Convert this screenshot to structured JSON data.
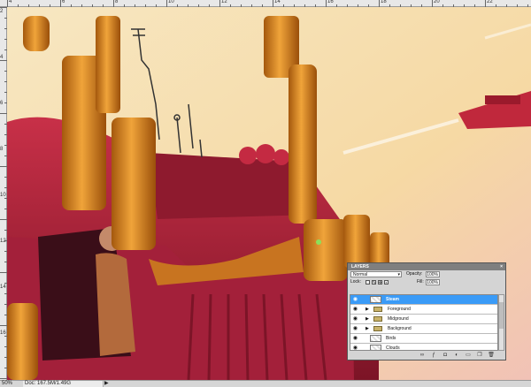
{
  "rulers": {
    "top_numbers": [
      "4",
      "6",
      "8",
      "10",
      "12",
      "14",
      "16",
      "18",
      "20",
      "22",
      "24"
    ],
    "left_numbers": [
      "2",
      "4",
      "6",
      "8",
      "10",
      "12",
      "14",
      "16"
    ]
  },
  "status": {
    "zoom": "50%",
    "doc": "Doc: 167.5M/1.49G",
    "arrow": "▶"
  },
  "layers_panel": {
    "title": "LAYERS",
    "close": "×",
    "blend_mode": "Normal",
    "opacity_label": "Opacity:",
    "opacity_value": "100%",
    "lock_label": "Lock:",
    "fill_label": "Fill:",
    "fill_value": "100%",
    "layers": [
      {
        "name": "Steam",
        "type": "layer",
        "selected": true
      },
      {
        "name": "Foreground",
        "type": "group",
        "selected": false
      },
      {
        "name": "Midground",
        "type": "group",
        "selected": false
      },
      {
        "name": "Background",
        "type": "group",
        "selected": false
      },
      {
        "name": "Birds",
        "type": "layer",
        "selected": false
      },
      {
        "name": "Clouds",
        "type": "layer",
        "selected": false
      }
    ],
    "bottom_icons": [
      "link-icon",
      "fx-icon",
      "mask-icon",
      "adjustment-icon",
      "folder-icon",
      "new-layer-icon",
      "trash-icon"
    ]
  },
  "colors": {
    "sky": "#f5ddb0",
    "vehicle_red": "#b8243a",
    "pipe_orange": "#d9881c",
    "selection_blue": "#3a9bf7"
  }
}
